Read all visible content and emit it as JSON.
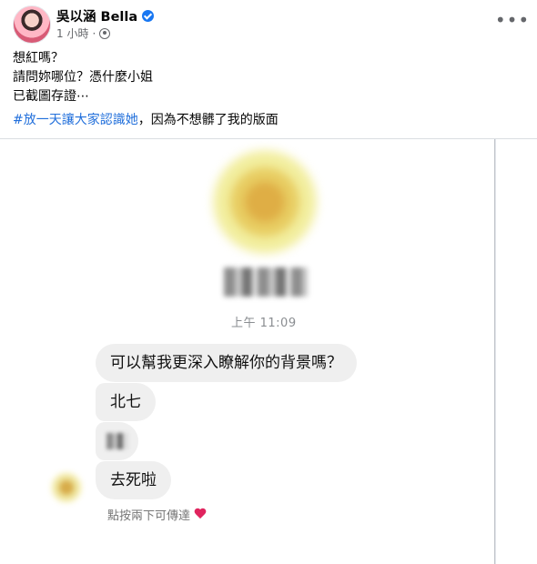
{
  "post": {
    "author": "吳以涵 Bella",
    "time": "1 小時",
    "lines": [
      "想紅嗎？",
      "請問妳哪位？憑什麼小姐",
      "已截圖存證⋯"
    ],
    "hashtag": "#放一天讓大家認識她",
    "hashtag_suffix": "，因為不想髒了我的版面",
    "more_label": "•••"
  },
  "chat": {
    "timestamp": "上午 11:09",
    "messages": [
      "可以幫我更深入瞭解你的背景嗎？",
      "北七",
      "",
      "去死啦"
    ],
    "hint": "點按兩下可傳達"
  },
  "colors": {
    "verified": "#1877f2",
    "hashtag": "#216fdb",
    "heart": "#e0245e",
    "bubble": "#efefef"
  },
  "icons": [
    "verified-badge-icon",
    "globe-icon",
    "more-options-icon",
    "heart-icon"
  ]
}
